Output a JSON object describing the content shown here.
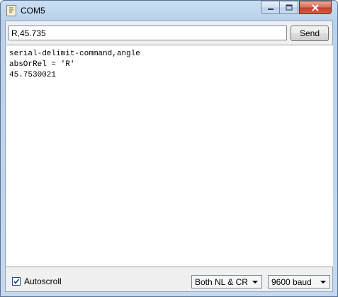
{
  "window": {
    "title": "COM5"
  },
  "input": {
    "command_value": "R,45.735"
  },
  "toolbar": {
    "send_label": "Send"
  },
  "output": {
    "lines": [
      "serial-delimit-command,angle",
      "absOrRel = 'R'",
      "45.7530021"
    ]
  },
  "status": {
    "autoscroll_label": "Autoscroll",
    "autoscroll_checked": true,
    "line_ending": "Both NL & CR",
    "baud": "9600 baud"
  },
  "icons": {
    "app": "serial-monitor-icon",
    "minimize": "minimize-icon",
    "maximize": "maximize-icon",
    "close": "close-icon",
    "dropdown": "chevron-down-icon",
    "check": "checkmark-icon"
  }
}
